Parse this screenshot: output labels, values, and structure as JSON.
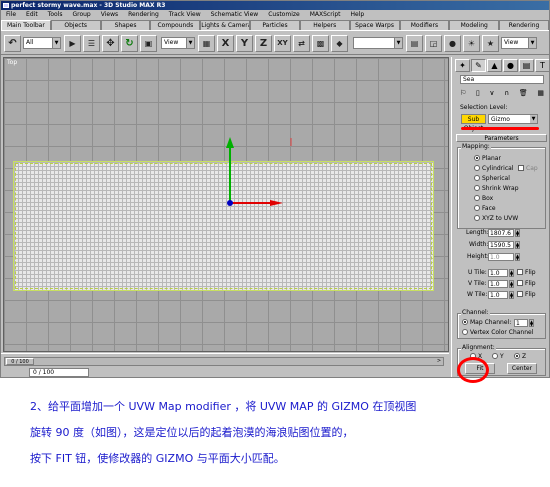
{
  "window": {
    "title": "perfect stormy wave.max - 3D Studio MAX R3"
  },
  "menu": [
    "File",
    "Edit",
    "Tools",
    "Group",
    "Views",
    "Rendering",
    "Track View",
    "Schematic View",
    "Customize",
    "MAXScript",
    "Help"
  ],
  "tabs": [
    {
      "label": "Main Toolbar",
      "active": true
    },
    {
      "label": "Objects"
    },
    {
      "label": "Shapes"
    },
    {
      "label": "Compounds"
    },
    {
      "label": "Lights & Cameras"
    },
    {
      "label": "Particles"
    },
    {
      "label": "Helpers"
    },
    {
      "label": "Space Warps"
    },
    {
      "label": "Modifiers"
    },
    {
      "label": "Modeling"
    },
    {
      "label": "Rendering"
    }
  ],
  "toolbar": {
    "selection_filter": "All",
    "reference_coord": "View",
    "named_selection": "",
    "render_type": "View",
    "axis_x": "X",
    "axis_y": "Y",
    "axis_z": "Z",
    "axis_xy": "XY"
  },
  "viewport": {
    "label": "Top",
    "axis_colors": {
      "x": "#e00000",
      "y": "#00b000",
      "origin": "#0000c0"
    }
  },
  "status": {
    "time_slider": "0 / 100",
    "slider_arrow": ">"
  },
  "panel": {
    "object_name": "Sea",
    "selection_level_label": "Selection Level:",
    "sub_object": "Sub Object",
    "sub_level": "Gizmo",
    "parameters_rollout": "Parameters",
    "mapping_label": "Mapping:",
    "mapping_options": [
      {
        "label": "Planar",
        "selected": true
      },
      {
        "label": "Cylindrical",
        "cap": "Cap"
      },
      {
        "label": "Spherical"
      },
      {
        "label": "Shrink Wrap"
      },
      {
        "label": "Box"
      },
      {
        "label": "Face"
      },
      {
        "label": "XYZ to UVW"
      }
    ],
    "length_label": "Length:",
    "length_value": "1807.6",
    "width_label": "Width:",
    "width_value": "1590.5",
    "height_label": "Height:",
    "height_value": "1.0",
    "u_tile_label": "U Tile:",
    "u_tile_value": "1.0",
    "v_tile_label": "V Tile:",
    "v_tile_value": "1.0",
    "w_tile_label": "W Tile:",
    "w_tile_value": "1.0",
    "flip_label": "Flip",
    "channel_label": "Channel:",
    "map_channel_label": "Map Channel:",
    "map_channel_value": "1",
    "vertex_color_label": "Vertex Color Channel",
    "alignment_label": "Alignment:",
    "align_x": "X",
    "align_y": "Y",
    "align_z": "Z",
    "fit_button": "Fit",
    "center_button": "Center"
  },
  "caption": {
    "line1": "2、给平面增加一个 UVW Map modifier ，将 UVW MAP 的 GIZMO 在顶视图",
    "line2": "旋转 90 度（如图），这是定位以后的起着泡漠的海浪贴图位置的，",
    "line3": "按下 FIT 钮，使修改器的 GIZMO 与平面大小匹配。"
  },
  "annotation_color": "#ff0000"
}
